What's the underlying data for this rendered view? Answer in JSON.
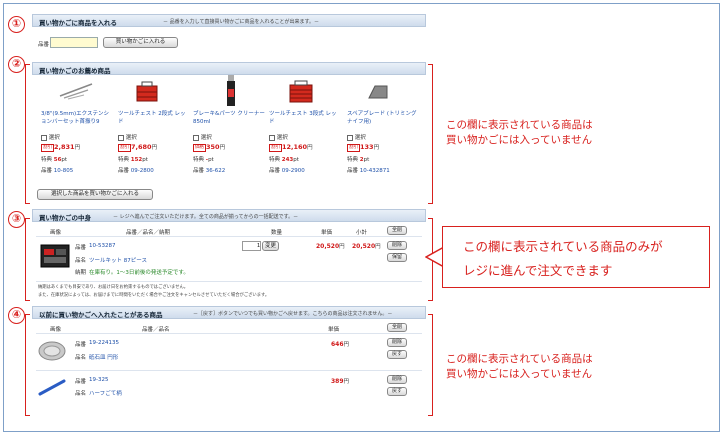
{
  "section1": {
    "number": "①",
    "title": "買い物かごに商品を入れる",
    "desc": "－ 品番を入力して直接買い物かごに商品を入れることが出来ます。－",
    "item_label": "品番",
    "input_value": "",
    "button": "買い物かごに入れる"
  },
  "section2": {
    "number": "②",
    "title": "買い物かごのお薦め商品",
    "products": [
      {
        "name": "3/8\"(9.5mm)エクステンションバーセット首振り9",
        "select": "選択",
        "sale_tag": "割引",
        "price": "2,831",
        "yen": "円",
        "points_label": "特典",
        "points": "56",
        "pt": "pt",
        "code_label": "品番",
        "code": "10-805",
        "icon": "extension-bar-image"
      },
      {
        "name": "ツールチェスト 2段式 レッド",
        "select": "選択",
        "sale_tag": "割引",
        "price": "7,680",
        "yen": "円",
        "points_label": "特典",
        "points": "152",
        "pt": "pt",
        "code_label": "品番",
        "code": "09-2800",
        "icon": "tool-chest-image"
      },
      {
        "name": "ブレーキ&パーツ クリーナー 850ml",
        "select": "選択",
        "sale_tag": "価格",
        "price": "350",
        "yen": "円",
        "points_label": "特典",
        "points": "-",
        "pt": "pt",
        "code_label": "品番",
        "code": "36-622",
        "icon": "spray-can-image"
      },
      {
        "name": "ツールチェスト 3段式 レッド",
        "select": "選択",
        "sale_tag": "割引",
        "price": "12,160",
        "yen": "円",
        "points_label": "特典",
        "points": "243",
        "pt": "pt",
        "code_label": "品番",
        "code": "09-2900",
        "icon": "tool-chest-image"
      },
      {
        "name": "スペアブレード (トリミングナイフ用)",
        "select": "選択",
        "sale_tag": "割引",
        "price": "133",
        "yen": "円",
        "points_label": "特典",
        "points": "2",
        "pt": "pt",
        "code_label": "品番",
        "code": "10-432871",
        "icon": "blade-image"
      }
    ],
    "button": "選択した商品を買い物かごに入れる",
    "note": [
      "この欄に表示されている商品は",
      "買い物かごには入っていません"
    ]
  },
  "section3": {
    "number": "③",
    "title": "買い物かごの中身",
    "desc": "－ レジへ進んでご注文いただけます。全ての商品が揃ってからの一括配送です。－",
    "headers": {
      "image": "画像",
      "name": "品番／品名／納期",
      "qty": "数量",
      "unit": "単価",
      "subtotal": "小計",
      "all_delete": "全削"
    },
    "item": {
      "code_label": "品番",
      "code": "10-53287",
      "name_label": "品名",
      "name": "ツールキット 87ピース",
      "delivery_label": "納期",
      "delivery": "在庫有り。1～3日前後の発送予定です。",
      "qty": "1",
      "change": "変更",
      "unit_price": "20,520",
      "subtotal": "20,520",
      "yen": "円",
      "delete": "削除",
      "keep": "保留"
    },
    "footnote1": "納期はあくまでも目安であり、お届け日をお約束するものではございません。",
    "footnote2": "また、在庫状況によっては、お届けまでに時間をいただく場合やご注文をキャンセルさせていただく場合がございます。",
    "callout": [
      "この欄に表示されている商品のみが",
      "レジに進んで注文できます"
    ]
  },
  "section4": {
    "number": "④",
    "title": "以前に買い物かごへ入れたことがある商品",
    "desc": "－［戻す］ボタンでいつでも買い物かごへ戻せます。こちらの商品は注文されません。－",
    "headers": {
      "image": "画像",
      "name": "品番／品名",
      "unit": "単価",
      "all_delete": "全削"
    },
    "items": [
      {
        "code_label": "品番",
        "code": "19-224135",
        "name_label": "品名",
        "name": "砥石皿 円形",
        "price": "646",
        "yen": "円",
        "delete": "削除",
        "restore": "戻す",
        "icon": "grinding-dish-image"
      },
      {
        "code_label": "品番",
        "code": "19-325",
        "name_label": "品名",
        "name": "ハーフごて柄",
        "price": "389",
        "yen": "円",
        "delete": "削除",
        "restore": "戻す",
        "icon": "trowel-image"
      }
    ],
    "note": [
      "この欄に表示されている商品は",
      "買い物かごには入っていません"
    ]
  },
  "colors": {
    "accent_red": "#d8211e",
    "header_blue": "#cfdcec",
    "price_red": "#d01818",
    "link_blue": "#1d4fa8"
  }
}
